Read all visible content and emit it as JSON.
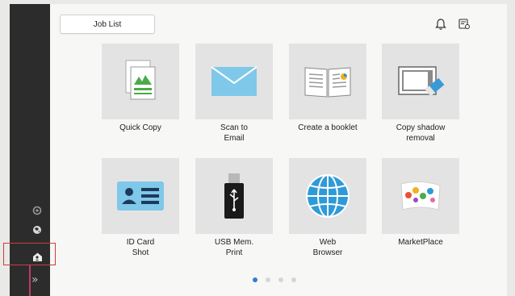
{
  "header": {
    "job_list_label": "Job List",
    "icons": [
      "bell-icon",
      "user-recall-icon"
    ]
  },
  "apps": [
    {
      "id": "quick-copy",
      "label": "Quick Copy",
      "icon": "copy-document-icon"
    },
    {
      "id": "scan-to-email",
      "label": "Scan to\nEmail",
      "icon": "envelope-icon"
    },
    {
      "id": "create-booklet",
      "label": "Create a booklet",
      "icon": "booklet-icon"
    },
    {
      "id": "copy-shadow-removal",
      "label": "Copy shadow\nremoval",
      "icon": "eraser-icon"
    },
    {
      "id": "id-card-shot",
      "label": "ID Card\nShot",
      "icon": "id-card-icon"
    },
    {
      "id": "usb-mem-print",
      "label": "USB Mem.\nPrint",
      "icon": "usb-icon"
    },
    {
      "id": "web-browser",
      "label": "Web\nBrowser",
      "icon": "globe-icon"
    },
    {
      "id": "marketplace",
      "label": "MarketPlace",
      "icon": "marketplace-icon"
    }
  ],
  "sidebar": {
    "icons": [
      "settings-icon",
      "language-icon",
      "home-users-icon",
      "expand-icon"
    ],
    "expand_glyph": "»"
  },
  "pagination": {
    "current": 1,
    "total": 4
  },
  "colors": {
    "accent": "#2f7fd0",
    "sidebar": "#2c2c2c",
    "highlight": "#d23a3a"
  }
}
